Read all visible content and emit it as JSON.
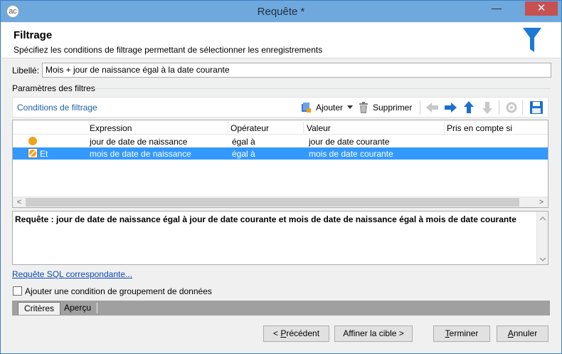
{
  "window": {
    "title": "Requête *",
    "minimize": "—",
    "close": "✕",
    "app_icon": "ac"
  },
  "header": {
    "title": "Filtrage",
    "subtitle": "Spécifiez les conditions de filtrage permettant de sélectionner les enregistrements",
    "icon": "funnel-icon"
  },
  "libelle": {
    "label": "Libellé:",
    "value": "Mois + jour de naissance égal à la date courante"
  },
  "params_label": "Paramètres des filtres",
  "toolbar": {
    "title": "Conditions de filtrage",
    "add_label": "Ajouter",
    "delete_label": "Supprimer"
  },
  "grid": {
    "columns": [
      "Expression",
      "Opérateur",
      "Valeur",
      "Pris en compte si"
    ],
    "rows": [
      {
        "prefix": "",
        "expression": "jour de date de naissance",
        "operator": "égal à",
        "value": "jour de date courante",
        "condition": ""
      },
      {
        "prefix": "Et",
        "expression": "mois de date de naissance",
        "operator": "égal à",
        "value": "mois de date courante",
        "condition": ""
      }
    ],
    "scroll_left": "<",
    "scroll_right": ">"
  },
  "query_text": "Requête : jour de date de naissance égal à jour de date courante et mois de date de naissance égal à mois de date courante",
  "sql_link": "Requête SQL correspondante...",
  "grouping_checkbox": {
    "label": "Ajouter une condition de groupement de données",
    "checked": false
  },
  "tabs": [
    "Critères",
    "Aperçu"
  ],
  "buttons": {
    "previous": {
      "pre": "< ",
      "accel": "P",
      "rest": "récédent"
    },
    "next": "Affiner la cible >",
    "finish": {
      "accel": "T",
      "rest": "erminer"
    },
    "cancel": {
      "accel": "A",
      "rest": "nnuler"
    }
  },
  "colors": {
    "accent": "#1a7ad4",
    "selection": "#3399ff",
    "link": "#0b48b5",
    "titlebar": "#6fa8dc"
  }
}
